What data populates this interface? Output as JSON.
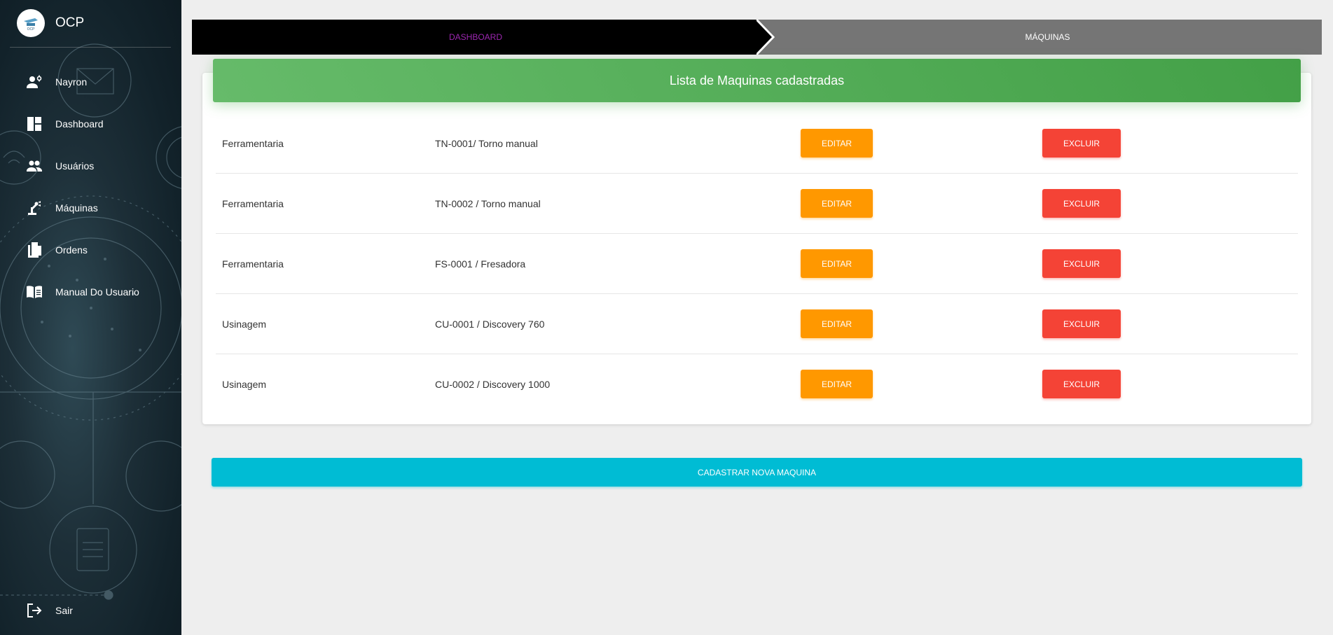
{
  "app": {
    "name": "OCP",
    "logo_icon": "ocp-logo-icon"
  },
  "sidebar": {
    "items": [
      {
        "label": "Nayron",
        "icon": "user-gear-icon"
      },
      {
        "label": "Dashboard",
        "icon": "dashboard-icon"
      },
      {
        "label": "Usuários",
        "icon": "people-icon"
      },
      {
        "label": "Máquinas",
        "icon": "robot-arm-icon"
      },
      {
        "label": "Ordens",
        "icon": "documents-icon"
      },
      {
        "label": "Manual Do Usuario",
        "icon": "book-icon"
      }
    ],
    "logout": {
      "label": "Sair",
      "icon": "logout-icon"
    }
  },
  "breadcrumb": {
    "items": [
      {
        "label": "DASHBOARD",
        "color": "#9c27b0"
      },
      {
        "label": "MÁQUINAS",
        "color": "#ffffff"
      }
    ]
  },
  "card": {
    "title": "Lista de Maquinas cadastradas",
    "edit_label": "EDITAR",
    "delete_label": "EXCLUIR",
    "rows": [
      {
        "sector": "Ferramentaria",
        "machine": "TN-0001/ Torno manual"
      },
      {
        "sector": "Ferramentaria",
        "machine": "TN-0002 / Torno manual"
      },
      {
        "sector": "Ferramentaria",
        "machine": "FS-0001 / Fresadora"
      },
      {
        "sector": "Usinagem",
        "machine": "CU-0001 / Discovery 760"
      },
      {
        "sector": "Usinagem",
        "machine": "CU-0002 / Discovery 1000"
      }
    ]
  },
  "actions": {
    "new_machine_label": "CADASTRAR NOVA MAQUINA"
  },
  "colors": {
    "header_green": "#4caf50",
    "edit_orange": "#ff9800",
    "delete_red": "#f44336",
    "new_cyan": "#00bcd4",
    "breadcrumb_active": "#000000",
    "breadcrumb_inactive": "#757575"
  }
}
